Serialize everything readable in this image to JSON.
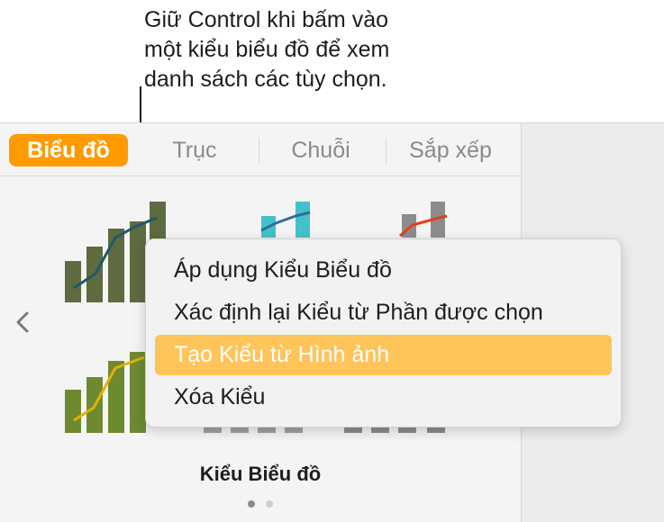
{
  "callout": {
    "text": "Giữ Control khi bấm vào\nmột kiểu biểu đồ để xem\ndanh sách các tùy chọn."
  },
  "tabs": [
    {
      "label": "Biểu đồ",
      "active": true
    },
    {
      "label": "Trục",
      "active": false
    },
    {
      "label": "Chuỗi",
      "active": false
    },
    {
      "label": "Sắp xếp",
      "active": false
    }
  ],
  "caption": "Kiểu Biểu đồ",
  "page_indicator": {
    "current": 1,
    "total": 2
  },
  "context_menu": {
    "items": [
      {
        "label": "Áp dụng Kiểu Biểu đồ",
        "highlighted": false
      },
      {
        "label": "Xác định lại Kiểu từ Phần được chọn",
        "highlighted": false
      },
      {
        "label": "Tạo Kiểu từ Hình ảnh",
        "highlighted": true
      },
      {
        "label": "Xóa Kiểu",
        "highlighted": false
      }
    ]
  },
  "colors": {
    "accent": "#ff9b00",
    "menu_highlight": "#ffc45a",
    "style1_bars": "#5e6b3f",
    "style1_line": "#1f5a6a",
    "style2_bars": "#44c1c8",
    "style2_line": "#2c6e9e",
    "style3_bars": "#8c8c8c",
    "style3_line": "#e0401e",
    "style4_bars": "#6e8a30",
    "style4_line": "#e2b100",
    "style5_bars": "#a0a0a0",
    "style6_bars": "#8c8c8c"
  },
  "icons": {
    "previous": "chevron-left-icon"
  }
}
